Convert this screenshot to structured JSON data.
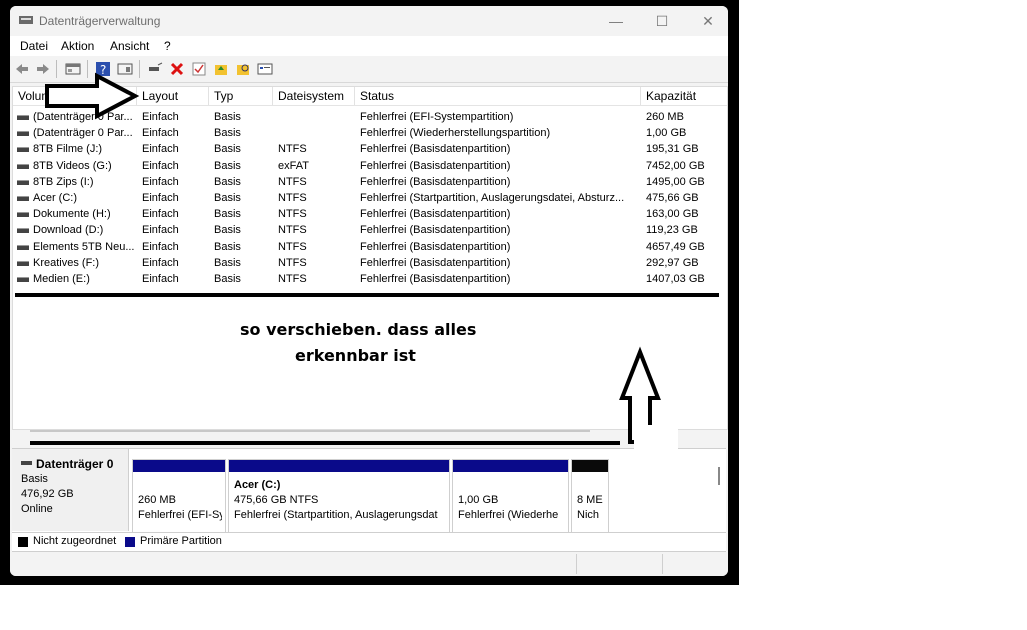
{
  "window": {
    "title": "Datenträgerverwaltung",
    "minimize": "—",
    "maximize": "☐",
    "close": "✕"
  },
  "menu": [
    "Datei",
    "Aktion",
    "Ansicht",
    "?"
  ],
  "columns": [
    "Volume",
    "Layout",
    "Typ",
    "Dateisystem",
    "Status",
    "Kapazität"
  ],
  "volumes": [
    {
      "name": "(Datenträger 0 Par...",
      "layout": "Einfach",
      "typ": "Basis",
      "fs": "",
      "status": "Fehlerfrei (EFI-Systempartition)",
      "cap": "260 MB"
    },
    {
      "name": "(Datenträger 0 Par...",
      "layout": "Einfach",
      "typ": "Basis",
      "fs": "",
      "status": "Fehlerfrei (Wiederherstellungspartition)",
      "cap": "1,00 GB"
    },
    {
      "name": "8TB Filme (J:)",
      "layout": "Einfach",
      "typ": "Basis",
      "fs": "NTFS",
      "status": "Fehlerfrei (Basisdatenpartition)",
      "cap": "195,31 GB"
    },
    {
      "name": "8TB Videos (G:)",
      "layout": "Einfach",
      "typ": "Basis",
      "fs": "exFAT",
      "status": "Fehlerfrei (Basisdatenpartition)",
      "cap": "7452,00 GB"
    },
    {
      "name": "8TB Zips (I:)",
      "layout": "Einfach",
      "typ": "Basis",
      "fs": "NTFS",
      "status": "Fehlerfrei (Basisdatenpartition)",
      "cap": "1495,00 GB"
    },
    {
      "name": "Acer (C:)",
      "layout": "Einfach",
      "typ": "Basis",
      "fs": "NTFS",
      "status": "Fehlerfrei (Startpartition, Auslagerungsdatei, Absturz...",
      "cap": "475,66 GB"
    },
    {
      "name": "Dokumente (H:)",
      "layout": "Einfach",
      "typ": "Basis",
      "fs": "NTFS",
      "status": "Fehlerfrei (Basisdatenpartition)",
      "cap": "163,00 GB"
    },
    {
      "name": "Download (D:)",
      "layout": "Einfach",
      "typ": "Basis",
      "fs": "NTFS",
      "status": "Fehlerfrei (Basisdatenpartition)",
      "cap": "119,23 GB"
    },
    {
      "name": "Elements 5TB Neu...",
      "layout": "Einfach",
      "typ": "Basis",
      "fs": "NTFS",
      "status": "Fehlerfrei (Basisdatenpartition)",
      "cap": "4657,49 GB"
    },
    {
      "name": "Kreatives (F:)",
      "layout": "Einfach",
      "typ": "Basis",
      "fs": "NTFS",
      "status": "Fehlerfrei (Basisdatenpartition)",
      "cap": "292,97 GB"
    },
    {
      "name": "Medien (E:)",
      "layout": "Einfach",
      "typ": "Basis",
      "fs": "NTFS",
      "status": "Fehlerfrei (Basisdatenpartition)",
      "cap": "1407,03 GB"
    }
  ],
  "disk": {
    "name": "Datenträger 0",
    "type": "Basis",
    "size": "476,92 GB",
    "state": "Online"
  },
  "partitions": [
    {
      "title": "",
      "size": "260 MB",
      "status": "Fehlerfrei (EFI-Sy"
    },
    {
      "title": "Acer  (C:)",
      "size": "475,66 GB NTFS",
      "status": "Fehlerfrei (Startpartition, Auslagerungsdat"
    },
    {
      "title": "",
      "size": "1,00 GB",
      "status": "Fehlerfrei (Wiederhe"
    },
    {
      "title": "",
      "size": "8 ME",
      "status": "Nich"
    }
  ],
  "legend": [
    {
      "label": "Nicht zugeordnet",
      "color": "#000000"
    },
    {
      "label": "Primäre Partition",
      "color": "#0a0a8a"
    }
  ],
  "annotation": {
    "line1": "so verschieben. dass alles",
    "line2": "erkennbar ist"
  }
}
